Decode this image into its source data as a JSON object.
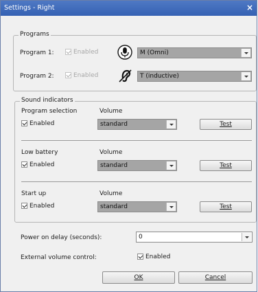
{
  "window": {
    "title": "Settings - Right",
    "close_glyph": "×"
  },
  "programs": {
    "legend": "Programs",
    "items": [
      {
        "label": "Program 1:",
        "enabled_label": "Enabled",
        "icon": "microphone-icon",
        "mode": "M (Omni)"
      },
      {
        "label": "Program 2:",
        "enabled_label": "Enabled",
        "icon": "telecoil-ear-icon",
        "mode": "T (inductive)"
      }
    ]
  },
  "sound": {
    "legend": "Sound indicators",
    "sections": [
      {
        "title": "Program selection",
        "volume_label": "Volume",
        "enabled_label": "Enabled",
        "volume": "standard",
        "test_label": "Test"
      },
      {
        "title": "Low battery",
        "volume_label": "Volume",
        "enabled_label": "Enabled",
        "volume": "standard",
        "test_label": "Test"
      },
      {
        "title": "Start up",
        "volume_label": "Volume",
        "enabled_label": "Enabled",
        "volume": "standard",
        "test_label": "Test"
      }
    ]
  },
  "power": {
    "label": "Power on delay (seconds):",
    "value": "0"
  },
  "external": {
    "label": "External volume control:",
    "enabled_label": "Enabled"
  },
  "buttons": {
    "ok": "OK",
    "cancel": "Cancel"
  }
}
